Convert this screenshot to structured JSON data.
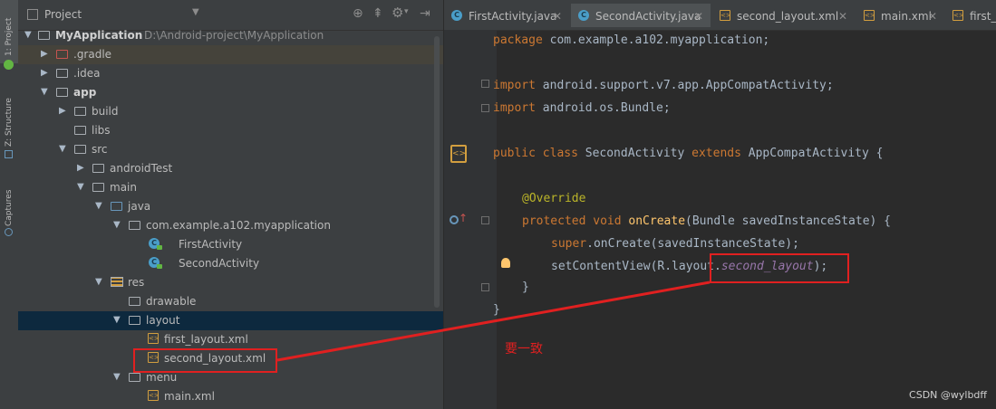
{
  "left_strip": {
    "tabs": [
      {
        "label": "1: Project"
      },
      {
        "label": "Z: Structure"
      },
      {
        "label": "Captures"
      }
    ]
  },
  "project_panel": {
    "title": "Project",
    "dropdown_icon": "chevron-down-icon",
    "toolbar_icons": [
      "sync-icon",
      "collapse-all-icon",
      "settings-gear-icon",
      "hide-panel-icon"
    ],
    "tree": [
      {
        "label": "MyApplication",
        "path": "D:\\Android-project\\MyApplication",
        "bold": true,
        "icon": "module-folder-icon",
        "expanded": true
      },
      {
        "label": ".gradle",
        "icon": "folder-icon",
        "expanded": false
      },
      {
        "label": ".idea",
        "icon": "folder-icon",
        "expanded": false
      },
      {
        "label": "app",
        "bold": true,
        "icon": "module-folder-icon",
        "expanded": true
      },
      {
        "label": "build",
        "icon": "folder-icon",
        "expanded": false
      },
      {
        "label": "libs",
        "icon": "folder-icon"
      },
      {
        "label": "src",
        "icon": "folder-icon",
        "expanded": true
      },
      {
        "label": "androidTest",
        "icon": "folder-icon",
        "expanded": false
      },
      {
        "label": "main",
        "icon": "folder-icon",
        "expanded": true
      },
      {
        "label": "java",
        "icon": "source-folder-icon",
        "expanded": true
      },
      {
        "label": "com.example.a102.myapplication",
        "icon": "package-icon",
        "expanded": true
      },
      {
        "label": "FirstActivity",
        "icon": "java-class-icon"
      },
      {
        "label": "SecondActivity",
        "icon": "java-class-icon"
      },
      {
        "label": "res",
        "icon": "resources-folder-icon",
        "expanded": true
      },
      {
        "label": "drawable",
        "icon": "folder-icon"
      },
      {
        "label": "layout",
        "icon": "folder-icon",
        "expanded": true,
        "selected": true
      },
      {
        "label": "first_layout.xml",
        "icon": "xml-file-icon"
      },
      {
        "label": "second_layout.xml",
        "icon": "xml-file-icon"
      },
      {
        "label": "menu",
        "icon": "folder-icon",
        "expanded": true
      },
      {
        "label": "main.xml",
        "icon": "xml-file-icon"
      }
    ]
  },
  "editor": {
    "tabs": [
      {
        "label": "FirstActivity.java",
        "icon": "java-class-icon",
        "active": false
      },
      {
        "label": "SecondActivity.java",
        "icon": "java-class-icon",
        "active": true
      },
      {
        "label": "second_layout.xml",
        "icon": "xml-file-icon",
        "active": false
      },
      {
        "label": "main.xml",
        "icon": "xml-file-icon",
        "active": false
      },
      {
        "label": "first_",
        "icon": "xml-file-icon",
        "active": false
      }
    ],
    "code": {
      "l1_kw": "package",
      "l1_rest": " com.example.a102.myapplication;",
      "l2_kw": "import",
      "l2_rest": " android.support.v7.app.AppCompatActivity;",
      "l3_kw": "import",
      "l3_rest": " android.os.Bundle;",
      "l4_kw1": "public class",
      "l4_name": " SecondActivity ",
      "l4_kw2": "extends",
      "l4_rest": " AppCompatActivity {",
      "l5_ann": "@Override",
      "l6_kw": "protected void",
      "l6_fn": " onCreate",
      "l6_rest": "(Bundle savedInstanceState) {",
      "l7_kw": "super",
      "l7_rest": ".onCreate(savedInstanceState);",
      "l8_start": "setContentView(R.layout.",
      "l8_field": "second_layout",
      "l8_end": ");",
      "l9": "}",
      "l10": "}"
    }
  },
  "annotation": {
    "text": "要一致",
    "color": "#e02020"
  },
  "watermark": "CSDN @wylbdff",
  "colors": {
    "keyword": "#cc7832",
    "annotation": "#bbb529",
    "method": "#ffc66d",
    "field": "#9876aa",
    "plain": "#a9b7c6",
    "selection": "#0d293e"
  }
}
